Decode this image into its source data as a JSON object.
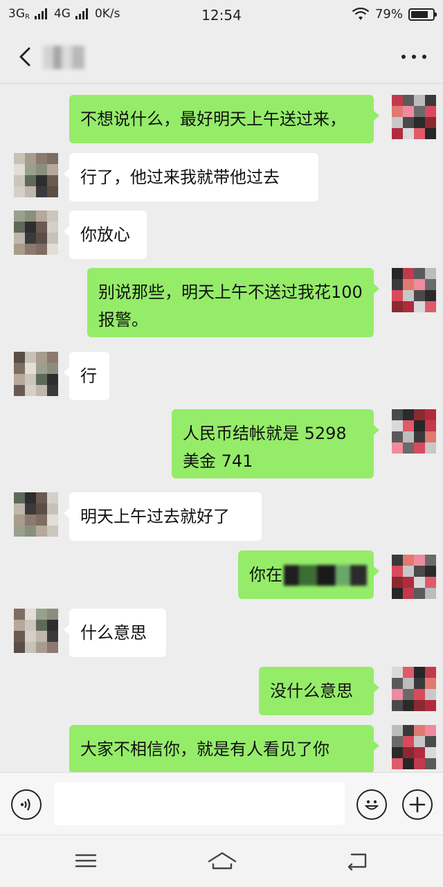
{
  "status_bar": {
    "network1": "3G",
    "network1_sup": "R",
    "network2": "4G",
    "speed": "0K/s",
    "time": "12:54",
    "battery": "79%",
    "battery_level": 0.79
  },
  "header": {
    "back_icon": "chevron-left-icon",
    "more_icon": "more-dots-icon"
  },
  "colors": {
    "incoming_bubble": "#ffffff",
    "outgoing_bubble": "#95ec69",
    "background": "#ededed"
  },
  "messages": [
    {
      "dir": "out",
      "text": "不想说什么，最好明天上午送过来，"
    },
    {
      "dir": "in",
      "text": "行了，他过来我就带他过去"
    },
    {
      "dir": "in",
      "text": "你放心"
    },
    {
      "dir": "out",
      "text": "别说那些，明天上午不送过我花100 报警。"
    },
    {
      "dir": "in",
      "text": "行"
    },
    {
      "dir": "out",
      "text": "人民币结帐就是 5298 美金 741"
    },
    {
      "dir": "in",
      "text": "明天上午过去就好了"
    },
    {
      "dir": "out",
      "text": "你在"
    },
    {
      "dir": "in",
      "text": "什么意思"
    },
    {
      "dir": "out",
      "text": "没什么意思"
    },
    {
      "dir": "out",
      "text": "大家不相信你，就是有人看见了你"
    }
  ],
  "input_bar": {
    "voice_icon": "voice-icon",
    "emoji_icon": "emoji-icon",
    "plus_icon": "plus-icon",
    "input_value": ""
  },
  "nav_bar": {
    "menu_icon": "menu-icon",
    "home_icon": "home-icon",
    "back_icon": "back-icon"
  }
}
